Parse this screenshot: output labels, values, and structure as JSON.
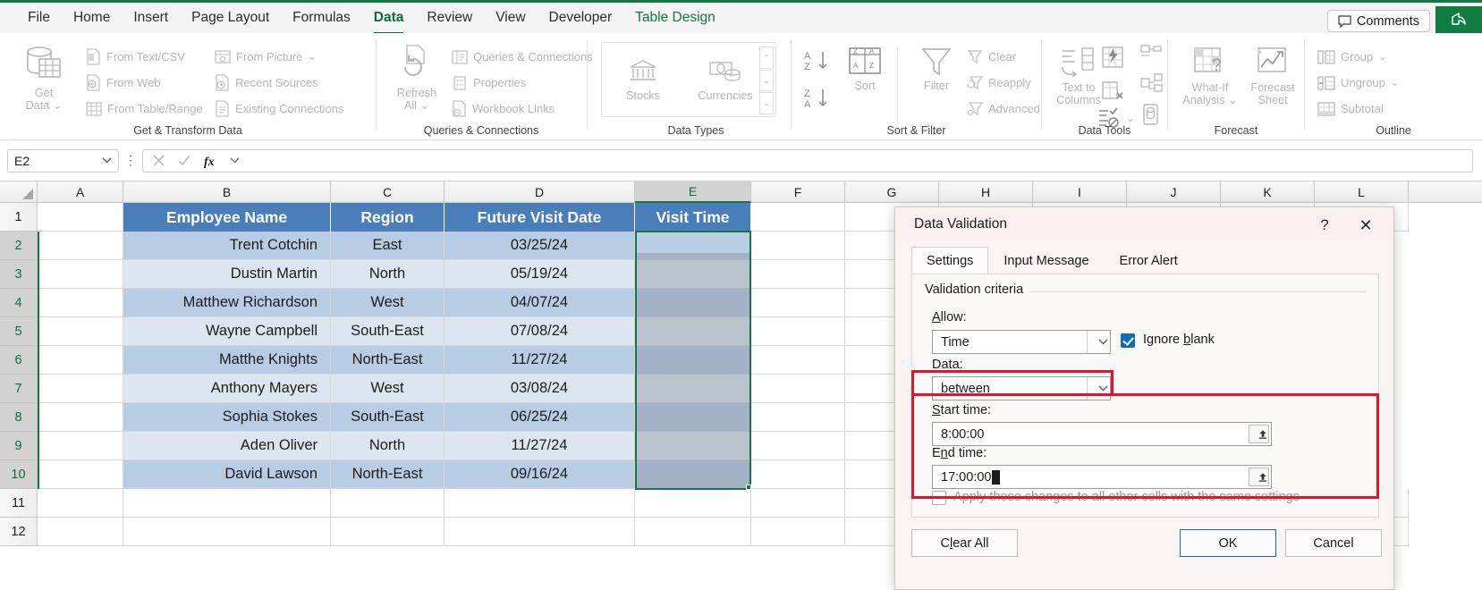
{
  "app": {
    "ribbon_tabs": [
      {
        "label": "File",
        "active": false
      },
      {
        "label": "Home",
        "active": false
      },
      {
        "label": "Insert",
        "active": false
      },
      {
        "label": "Page Layout",
        "active": false
      },
      {
        "label": "Formulas",
        "active": false
      },
      {
        "label": "Data",
        "active": true
      },
      {
        "label": "Review",
        "active": false
      },
      {
        "label": "View",
        "active": false
      },
      {
        "label": "Developer",
        "active": false
      },
      {
        "label": "Table Design",
        "active": false,
        "accent": true
      }
    ],
    "comments_label": "Comments",
    "accent_green": "#107c41"
  },
  "ribbon": {
    "groups": [
      {
        "label": "Get & Transform Data"
      },
      {
        "label": "Queries & Connections"
      },
      {
        "label": "Data Types"
      },
      {
        "label": "Sort & Filter"
      },
      {
        "label": "Data Tools"
      },
      {
        "label": "Forecast"
      },
      {
        "label": "Outline"
      }
    ],
    "get_data": {
      "line1": "Get",
      "line2": "Data"
    },
    "get_transform_items": [
      "From Text/CSV",
      "From Web",
      "From Table/Range",
      "From Picture",
      "Recent Sources",
      "Existing Connections"
    ],
    "refresh_all": {
      "line1": "Refresh",
      "line2": "All"
    },
    "queries_items": [
      "Queries & Connections",
      "Properties",
      "Workbook Links"
    ],
    "data_types": [
      "Stocks",
      "Currencies"
    ],
    "sort_label": "Sort",
    "filter_label": "Filter",
    "filter_items": [
      "Clear",
      "Reapply",
      "Advanced"
    ],
    "text_to_columns": {
      "line1": "Text to",
      "line2": "Columns"
    },
    "what_if": {
      "line1": "What-If",
      "line2": "Analysis"
    },
    "forecast_sheet": {
      "line1": "Forecast",
      "line2": "Sheet"
    },
    "outline_items": [
      "Group",
      "Ungroup",
      "Subtotal"
    ]
  },
  "formula_bar": {
    "name_box_value": "E2",
    "formula_value": ""
  },
  "sheet": {
    "column_headers": [
      "A",
      "B",
      "C",
      "D",
      "E",
      "F",
      "G",
      "H",
      "I",
      "J",
      "K",
      "L"
    ],
    "selected_column": "E",
    "row_headers": [
      "1",
      "2",
      "3",
      "4",
      "5",
      "6",
      "7",
      "8",
      "9",
      "10",
      "11",
      "12"
    ],
    "table_headers": [
      "Employee Name",
      "Region",
      "Future Visit Date",
      "Visit Time"
    ],
    "rows": [
      {
        "name": "Trent Cotchin",
        "region": "East",
        "date": "03/25/24",
        "time": ""
      },
      {
        "name": "Dustin Martin",
        "region": "North",
        "date": "05/19/24",
        "time": ""
      },
      {
        "name": "Matthew Richardson",
        "region": "West",
        "date": "04/07/24",
        "time": ""
      },
      {
        "name": "Wayne Campbell",
        "region": "South-East",
        "date": "07/08/24",
        "time": ""
      },
      {
        "name": "Matthe Knights",
        "region": "North-East",
        "date": "11/27/24",
        "time": ""
      },
      {
        "name": "Anthony Mayers",
        "region": "West",
        "date": "03/08/24",
        "time": ""
      },
      {
        "name": "Sophia Stokes",
        "region": "South-East",
        "date": "06/25/24",
        "time": ""
      },
      {
        "name": "Aden Oliver",
        "region": "North",
        "date": "11/27/24",
        "time": ""
      },
      {
        "name": "David Lawson",
        "region": "North-East",
        "date": "09/16/24",
        "time": ""
      }
    ],
    "header_fill": "#4a7ebb",
    "band_a": "#b8cce4",
    "band_b": "#dce6f1"
  },
  "dialog": {
    "title": "Data Validation",
    "help_glyph": "?",
    "close_glyph": "✕",
    "tabs": [
      {
        "label": "Settings",
        "active": true
      },
      {
        "label": "Input Message",
        "active": false
      },
      {
        "label": "Error Alert",
        "active": false
      }
    ],
    "group_legend": "Validation criteria",
    "allow_label": "Allow:",
    "allow_value": "Time",
    "ignore_blank_label": "Ignore blank",
    "ignore_blank_checked": true,
    "data_label": "Data:",
    "data_value": "between",
    "start_time_label": "Start time:",
    "start_time_value": "8:00:00",
    "end_time_label": "End time:",
    "end_time_value": "17:00:00",
    "apply_all_label": "Apply these changes to all other cells with the same settings",
    "apply_all_checked": false,
    "clear_all_label": "Clear All",
    "ok_label": "OK",
    "cancel_label": "Cancel",
    "highlight_color": "#e8112d"
  }
}
